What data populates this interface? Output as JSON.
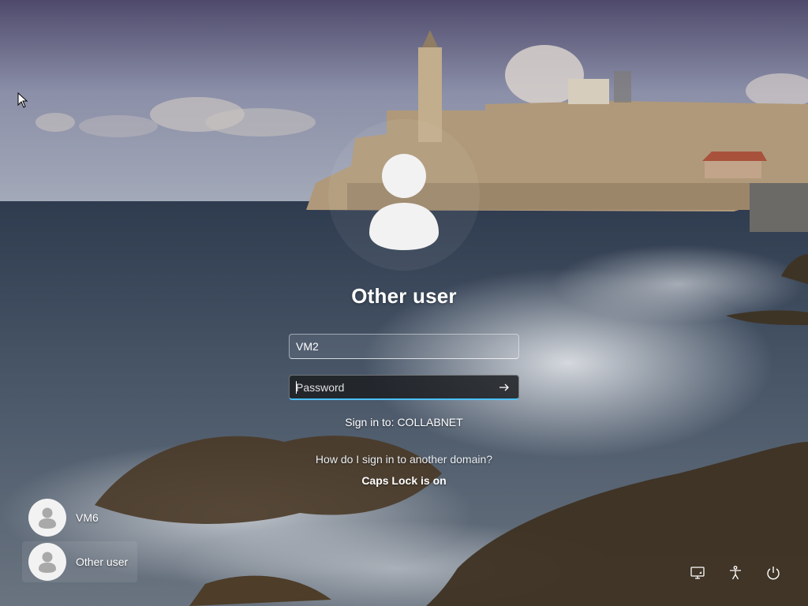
{
  "background": {
    "sky_top": "#5d5c7c",
    "sky_mid": "#9aa3b3",
    "sea": "#3c4b5c",
    "fortress": "#b79e79",
    "foam": "#dfe3e8",
    "rock": "#4d3d28"
  },
  "login": {
    "avatar_icon": "user-silhouette-icon",
    "title": "Other user",
    "username_value": "VM2",
    "password_placeholder": "Password",
    "submit_icon": "arrow-right-icon",
    "sign_in_to": "Sign in to: COLLABNET",
    "domain_link": "How do I sign in to another domain?",
    "caps_lock": "Caps Lock is on",
    "accent": "#4cc2ff"
  },
  "users": [
    {
      "label": "VM6",
      "selected": false,
      "icon": "user-silhouette-icon"
    },
    {
      "label": "Other user",
      "selected": true,
      "icon": "user-silhouette-icon"
    }
  ],
  "tray": {
    "network_icon": "network-icon",
    "accessibility_icon": "accessibility-icon",
    "power_icon": "power-icon"
  }
}
